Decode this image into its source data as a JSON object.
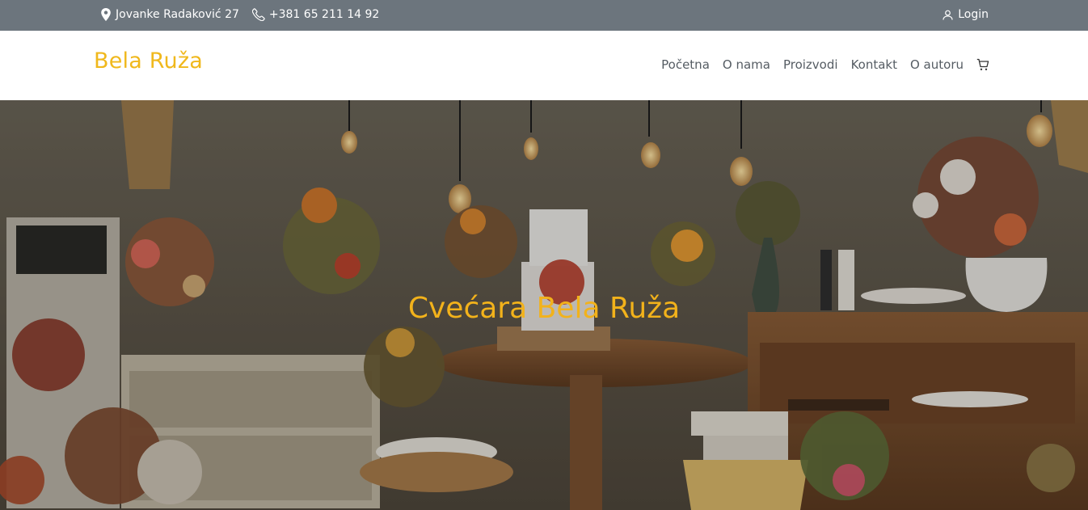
{
  "topbar": {
    "address": "Jovanke Radaković 27",
    "phone": "+381 65 211 14 92",
    "login": "Login"
  },
  "navbar": {
    "brand": "Bela Ruža",
    "links": [
      "Početna",
      "O nama",
      "Proizvodi",
      "Kontakt",
      "O autoru"
    ],
    "cart_icon": "cart-icon"
  },
  "hero": {
    "title": "Cvećara Bela Ruža",
    "image": "dessert-table-with-flowers-and-cake"
  },
  "colors": {
    "accent": "#f0b81c",
    "topbar_bg": "#6c757d",
    "nav_text": "#555c63"
  }
}
